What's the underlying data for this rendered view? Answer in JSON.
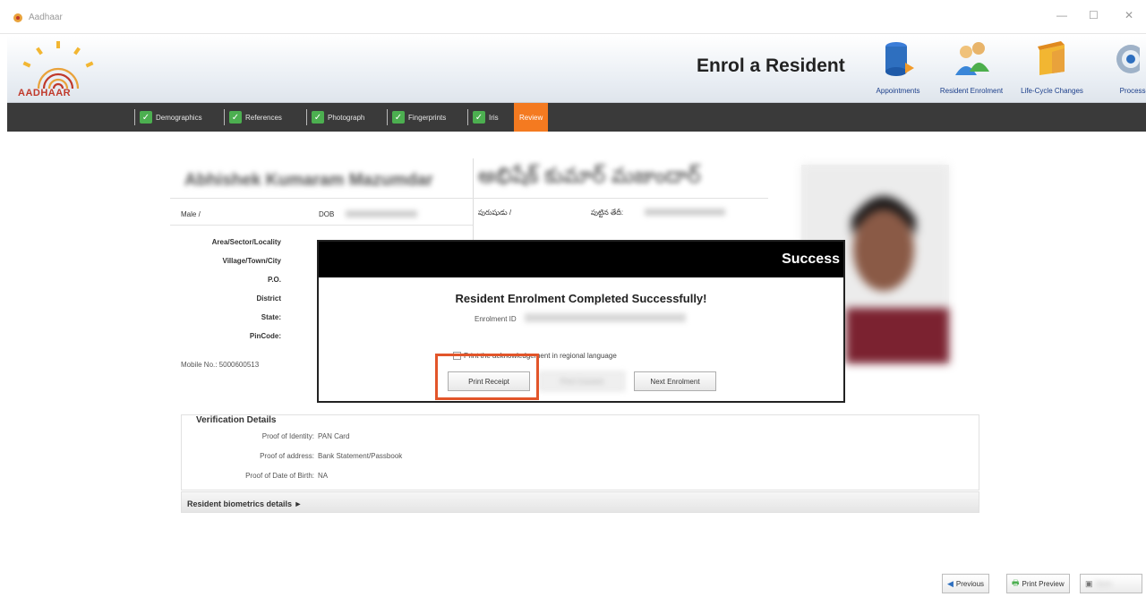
{
  "window": {
    "title": "Aadhaar",
    "minimize": "—",
    "maximize": "☐",
    "close": "✕"
  },
  "header": {
    "logo_text": "AADHAAR",
    "page_title": "Enrol a Resident",
    "tools": [
      {
        "label": "Appointments",
        "icon": "database-icon"
      },
      {
        "label": "Resident Enrolment",
        "icon": "users-icon"
      },
      {
        "label": "Life-Cycle Changes",
        "icon": "box-icon"
      },
      {
        "label": "Processes",
        "icon": "gear-icon"
      }
    ]
  },
  "steps": [
    {
      "label": "Demographics",
      "done": true
    },
    {
      "label": "References",
      "done": true
    },
    {
      "label": "Photograph",
      "done": true
    },
    {
      "label": "Fingerprints",
      "done": true
    },
    {
      "label": "Iris",
      "done": true
    },
    {
      "label": "Review",
      "done": false,
      "active": true
    }
  ],
  "resident": {
    "name_en": "Abhishek Kumaram Mazumdar",
    "name_te": "అభిషేక్ కుమార్ మజుందార్",
    "gender_label": "Male /",
    "dob_label": "DOB",
    "gender_te_label": "పురుషుడు /",
    "dob_te_label": "పుట్టిన తేదీ:",
    "address_labels": [
      "Area/Sector/Locality",
      "Village/Town/City",
      "P.O.",
      "District",
      "State:",
      "PinCode:"
    ],
    "mobile": "Mobile No.: 5000600513"
  },
  "verification": {
    "title": "Verification Details",
    "rows": [
      {
        "label": "Proof of Identity:",
        "value": "PAN Card"
      },
      {
        "label": "Proof of address:",
        "value": "Bank Statement/Passbook"
      },
      {
        "label": "Proof of Date of Birth:",
        "value": "NA"
      }
    ]
  },
  "biometrics": {
    "label": "Resident biometrics details ►"
  },
  "dialog": {
    "title": "Success",
    "message": "Resident Enrolment Completed Successfully!",
    "enrolment_id_label": "Enrolment ID",
    "checkbox_label": "Print the acknowledgement in regional language",
    "print_receipt": "Print Receipt",
    "print_secondary": "Print Consent",
    "next_enrolment": "Next Enrolment"
  },
  "footer": {
    "previous": "Previous",
    "print_preview": "Print Preview",
    "save": "Save"
  },
  "colors": {
    "nav_bg": "#3a3a3a",
    "active_step": "#f47a20",
    "check_green": "#4caf50",
    "highlight": "#e2552a",
    "dialog_header": "#000000"
  }
}
